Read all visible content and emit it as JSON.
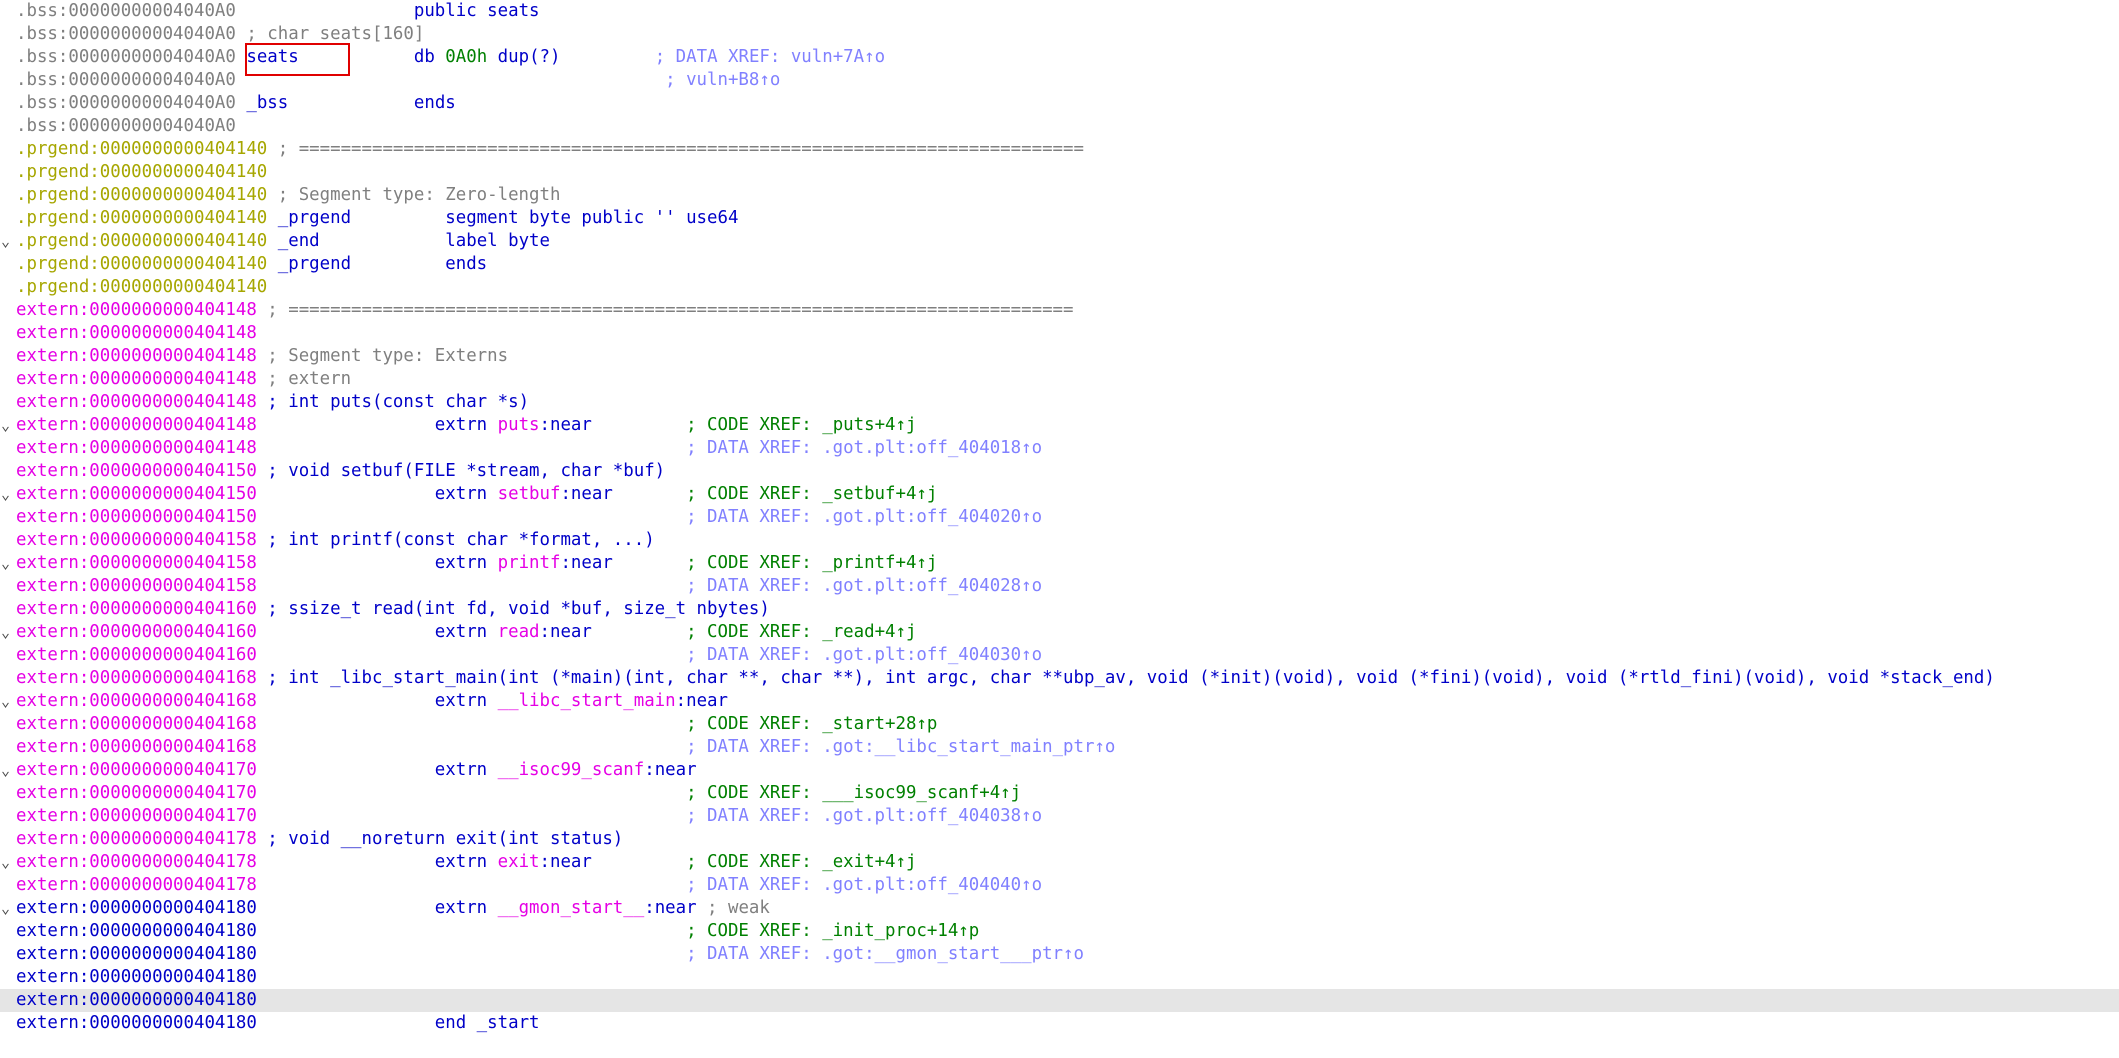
{
  "lines": [
    {
      "addr": ".bss:00000000004040A0",
      "fold": "",
      "hl": false,
      "segments": [
        {
          "t": "                 public seats",
          "c": "kw"
        }
      ]
    },
    {
      "addr": ".bss:00000000004040A0",
      "fold": "",
      "hl": false,
      "segments": [
        {
          "t": " ; char seats[160]",
          "c": "cmt"
        }
      ]
    },
    {
      "addr": ".bss:00000000004040A0",
      "fold": "",
      "hl": false,
      "segments": [
        {
          "t": " seats",
          "c": "name"
        },
        {
          "t": "           db ",
          "c": "kw"
        },
        {
          "t": "0A0h",
          "c": "num"
        },
        {
          "t": " dup(?)",
          "c": "kw"
        },
        {
          "t": "         ; DATA XREF: vuln+7A↑o",
          "c": "dxref"
        }
      ]
    },
    {
      "addr": ".bss:00000000004040A0",
      "fold": "",
      "hl": false,
      "segments": [
        {
          "t": "                                         ; vuln+B8↑o",
          "c": "dxref"
        }
      ]
    },
    {
      "addr": ".bss:00000000004040A0",
      "fold": "",
      "hl": false,
      "segments": [
        {
          "t": " _bss",
          "c": "name"
        },
        {
          "t": "            ends",
          "c": "kw"
        }
      ]
    },
    {
      "addr": ".bss:00000000004040A0",
      "fold": "",
      "hl": false,
      "segments": []
    },
    {
      "addr": ".prgend:0000000000404140",
      "fold": "",
      "hl": false,
      "segments": [
        {
          "t": " ; ===========================================================================",
          "c": "cmt"
        }
      ]
    },
    {
      "addr": ".prgend:0000000000404140",
      "fold": "",
      "hl": false,
      "segments": []
    },
    {
      "addr": ".prgend:0000000000404140",
      "fold": "",
      "hl": false,
      "segments": [
        {
          "t": " ; Segment type: Zero-length",
          "c": "cmt"
        }
      ]
    },
    {
      "addr": ".prgend:0000000000404140",
      "fold": "",
      "hl": false,
      "segments": [
        {
          "t": " _prgend",
          "c": "name"
        },
        {
          "t": "         segment byte public '' use64",
          "c": "kw"
        }
      ]
    },
    {
      "addr": ".prgend:0000000000404140",
      "fold": "⌄",
      "hl": false,
      "segments": [
        {
          "t": " _end",
          "c": "name"
        },
        {
          "t": "            label byte",
          "c": "kw"
        }
      ]
    },
    {
      "addr": ".prgend:0000000000404140",
      "fold": "",
      "hl": false,
      "segments": [
        {
          "t": " _prgend",
          "c": "name"
        },
        {
          "t": "         ends",
          "c": "kw"
        }
      ]
    },
    {
      "addr": ".prgend:0000000000404140",
      "fold": "",
      "hl": false,
      "segments": []
    },
    {
      "addr": "extern:0000000000404148",
      "fold": "",
      "hl": false,
      "segments": [
        {
          "t": " ; ===========================================================================",
          "c": "cmt"
        }
      ]
    },
    {
      "addr": "extern:0000000000404148",
      "fold": "",
      "hl": false,
      "segments": []
    },
    {
      "addr": "extern:0000000000404148",
      "fold": "",
      "hl": false,
      "segments": [
        {
          "t": " ; Segment type: Externs",
          "c": "cmt"
        }
      ]
    },
    {
      "addr": "extern:0000000000404148",
      "fold": "",
      "hl": false,
      "segments": [
        {
          "t": " ; extern",
          "c": "cmt"
        }
      ]
    },
    {
      "addr": "extern:0000000000404148",
      "fold": "",
      "hl": false,
      "segments": [
        {
          "t": " ; int puts(const char *s)",
          "c": "sig"
        }
      ]
    },
    {
      "addr": "extern:0000000000404148",
      "fold": "⌄",
      "hl": false,
      "segments": [
        {
          "t": "                 extrn ",
          "c": "kw"
        },
        {
          "t": "puts",
          "c": "imp"
        },
        {
          "t": ":near         ",
          "c": "kw"
        },
        {
          "t": "; CODE XREF: _puts+4↑j",
          "c": "xref"
        }
      ]
    },
    {
      "addr": "extern:0000000000404148",
      "fold": "",
      "hl": false,
      "segments": [
        {
          "t": "                                         ; DATA XREF: .got.plt:off_404018↑o",
          "c": "dxref"
        }
      ]
    },
    {
      "addr": "extern:0000000000404150",
      "fold": "",
      "hl": false,
      "segments": [
        {
          "t": " ; void setbuf(FILE *stream, char *buf)",
          "c": "sig"
        }
      ]
    },
    {
      "addr": "extern:0000000000404150",
      "fold": "⌄",
      "hl": false,
      "segments": [
        {
          "t": "                 extrn ",
          "c": "kw"
        },
        {
          "t": "setbuf",
          "c": "imp"
        },
        {
          "t": ":near       ",
          "c": "kw"
        },
        {
          "t": "; CODE XREF: _setbuf+4↑j",
          "c": "xref"
        }
      ]
    },
    {
      "addr": "extern:0000000000404150",
      "fold": "",
      "hl": false,
      "segments": [
        {
          "t": "                                         ; DATA XREF: .got.plt:off_404020↑o",
          "c": "dxref"
        }
      ]
    },
    {
      "addr": "extern:0000000000404158",
      "fold": "",
      "hl": false,
      "segments": [
        {
          "t": " ; int printf(const char *format, ...)",
          "c": "sig"
        }
      ]
    },
    {
      "addr": "extern:0000000000404158",
      "fold": "⌄",
      "hl": false,
      "segments": [
        {
          "t": "                 extrn ",
          "c": "kw"
        },
        {
          "t": "printf",
          "c": "imp"
        },
        {
          "t": ":near       ",
          "c": "kw"
        },
        {
          "t": "; CODE XREF: _printf+4↑j",
          "c": "xref"
        }
      ]
    },
    {
      "addr": "extern:0000000000404158",
      "fold": "",
      "hl": false,
      "segments": [
        {
          "t": "                                         ; DATA XREF: .got.plt:off_404028↑o",
          "c": "dxref"
        }
      ]
    },
    {
      "addr": "extern:0000000000404160",
      "fold": "",
      "hl": false,
      "segments": [
        {
          "t": " ; ssize_t read(int fd, void *buf, size_t nbytes)",
          "c": "sig"
        }
      ]
    },
    {
      "addr": "extern:0000000000404160",
      "fold": "⌄",
      "hl": false,
      "segments": [
        {
          "t": "                 extrn ",
          "c": "kw"
        },
        {
          "t": "read",
          "c": "imp"
        },
        {
          "t": ":near         ",
          "c": "kw"
        },
        {
          "t": "; CODE XREF: _read+4↑j",
          "c": "xref"
        }
      ]
    },
    {
      "addr": "extern:0000000000404160",
      "fold": "",
      "hl": false,
      "segments": [
        {
          "t": "                                         ; DATA XREF: .got.plt:off_404030↑o",
          "c": "dxref"
        }
      ]
    },
    {
      "addr": "extern:0000000000404168",
      "fold": "",
      "hl": false,
      "segments": [
        {
          "t": " ; int _libc_start_main(int (*main)(int, char **, char **), int argc, char **ubp_av, void (*init)(void), void (*fini)(void), void (*rtld_fini)(void), void *stack_end)",
          "c": "sig"
        }
      ]
    },
    {
      "addr": "extern:0000000000404168",
      "fold": "⌄",
      "hl": false,
      "segments": [
        {
          "t": "                 extrn ",
          "c": "kw"
        },
        {
          "t": "__libc_start_main",
          "c": "imp"
        },
        {
          "t": ":near",
          "c": "kw"
        }
      ]
    },
    {
      "addr": "extern:0000000000404168",
      "fold": "",
      "hl": false,
      "segments": [
        {
          "t": "                                         ; CODE XREF: _start+28↑p",
          "c": "xref"
        }
      ]
    },
    {
      "addr": "extern:0000000000404168",
      "fold": "",
      "hl": false,
      "segments": [
        {
          "t": "                                         ; DATA XREF: .got:__libc_start_main_ptr↑o",
          "c": "dxref"
        }
      ]
    },
    {
      "addr": "extern:0000000000404170",
      "fold": "⌄",
      "hl": false,
      "segments": [
        {
          "t": "                 extrn ",
          "c": "kw"
        },
        {
          "t": "__isoc99_scanf",
          "c": "imp"
        },
        {
          "t": ":near",
          "c": "kw"
        }
      ]
    },
    {
      "addr": "extern:0000000000404170",
      "fold": "",
      "hl": false,
      "segments": [
        {
          "t": "                                         ; CODE XREF: ___isoc99_scanf+4↑j",
          "c": "xref"
        }
      ]
    },
    {
      "addr": "extern:0000000000404170",
      "fold": "",
      "hl": false,
      "segments": [
        {
          "t": "                                         ; DATA XREF: .got.plt:off_404038↑o",
          "c": "dxref"
        }
      ]
    },
    {
      "addr": "extern:0000000000404178",
      "fold": "",
      "hl": false,
      "segments": [
        {
          "t": " ; void __noreturn exit(int status)",
          "c": "sig"
        }
      ]
    },
    {
      "addr": "extern:0000000000404178",
      "fold": "⌄",
      "hl": false,
      "segments": [
        {
          "t": "                 extrn ",
          "c": "kw"
        },
        {
          "t": "exit",
          "c": "imp"
        },
        {
          "t": ":near         ",
          "c": "kw"
        },
        {
          "t": "; CODE XREF: _exit+4↑j",
          "c": "xref"
        }
      ]
    },
    {
      "addr": "extern:0000000000404178",
      "fold": "",
      "hl": false,
      "segments": [
        {
          "t": "                                         ; DATA XREF: .got.plt:off_404040↑o",
          "c": "dxref"
        }
      ]
    },
    {
      "addr": "extern:0000000000404180",
      "fold": "⌄",
      "hl": false,
      "blue": true,
      "segments": [
        {
          "t": "                 extrn ",
          "c": "kw"
        },
        {
          "t": "__gmon_start__",
          "c": "imp"
        },
        {
          "t": ":near",
          "c": "kw"
        },
        {
          "t": " ; weak",
          "c": "cmt"
        }
      ]
    },
    {
      "addr": "extern:0000000000404180",
      "fold": "",
      "hl": false,
      "blue": true,
      "segments": [
        {
          "t": "                                         ; CODE XREF: _init_proc+14↑p",
          "c": "xref"
        }
      ]
    },
    {
      "addr": "extern:0000000000404180",
      "fold": "",
      "hl": false,
      "blue": true,
      "segments": [
        {
          "t": "                                         ; DATA XREF: .got:__gmon_start___ptr↑o",
          "c": "dxref"
        }
      ]
    },
    {
      "addr": "extern:0000000000404180",
      "fold": "",
      "hl": false,
      "blue": true,
      "segments": []
    },
    {
      "addr": "extern:0000000000404180",
      "fold": "",
      "hl": true,
      "blue": true,
      "segments": []
    },
    {
      "addr": "extern:0000000000404180",
      "fold": "",
      "hl": false,
      "blue": true,
      "segments": [
        {
          "t": "                 end _start",
          "c": "kw"
        }
      ]
    }
  ],
  "colors": {
    "bss_address": "#7f7f7f",
    "prgend_address": "#a6a600",
    "extern_address": "#e500e5",
    "extern_address_active": "#0000c8",
    "highlight_box": "#e00000",
    "current_line": "#e5e5e5"
  }
}
